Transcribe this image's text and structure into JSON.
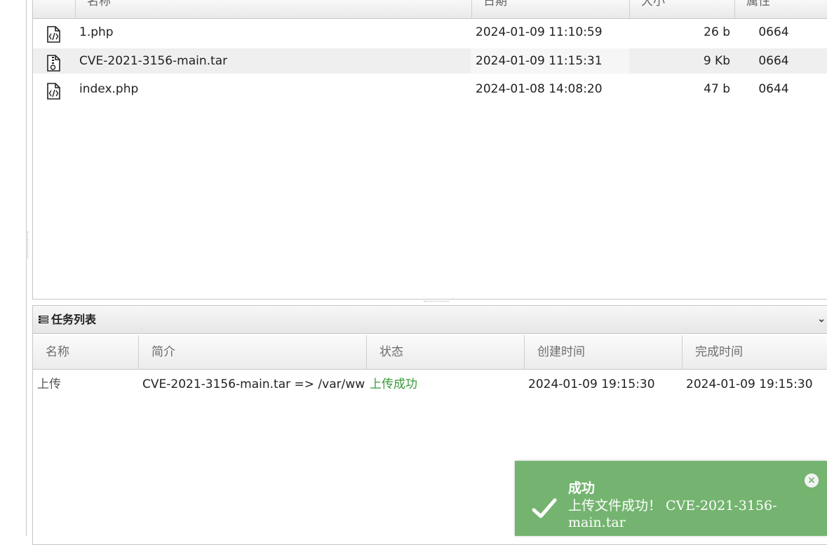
{
  "file_table": {
    "columns": {
      "name": "名称",
      "date": "日期",
      "size": "大小",
      "attr": "属性"
    },
    "rows": [
      {
        "icon": "code-file-icon",
        "name": "1.php",
        "date": "2024-01-09 11:10:59",
        "size": "26 b",
        "attr": "0664"
      },
      {
        "icon": "archive-file-icon",
        "name": "CVE-2021-3156-main.tar",
        "date": "2024-01-09 11:15:31",
        "size": "9 Kb",
        "attr": "0664"
      },
      {
        "icon": "code-file-icon",
        "name": "index.php",
        "date": "2024-01-08 14:08:20",
        "size": "47 b",
        "attr": "0644"
      }
    ]
  },
  "task_panel": {
    "title": "任务列表",
    "icon": "list-icon",
    "columns": {
      "name": "名称",
      "desc": "简介",
      "status": "状态",
      "created": "创建时间",
      "done": "完成时间"
    },
    "rows": [
      {
        "name": "上传",
        "desc": "CVE-2021-3156-main.tar => /var/ww",
        "status": "上传成功",
        "created": "2024-01-09 19:15:30",
        "done": "2024-01-09 19:15:30"
      }
    ]
  },
  "toast": {
    "title": "成功",
    "message": "上传文件成功！ CVE-2021-3156-main.tar",
    "close": "×",
    "icon": "check-icon",
    "color": "#74b470"
  },
  "colors": {
    "success_text": "#3a9a3a",
    "border": "#c6c6c6"
  }
}
